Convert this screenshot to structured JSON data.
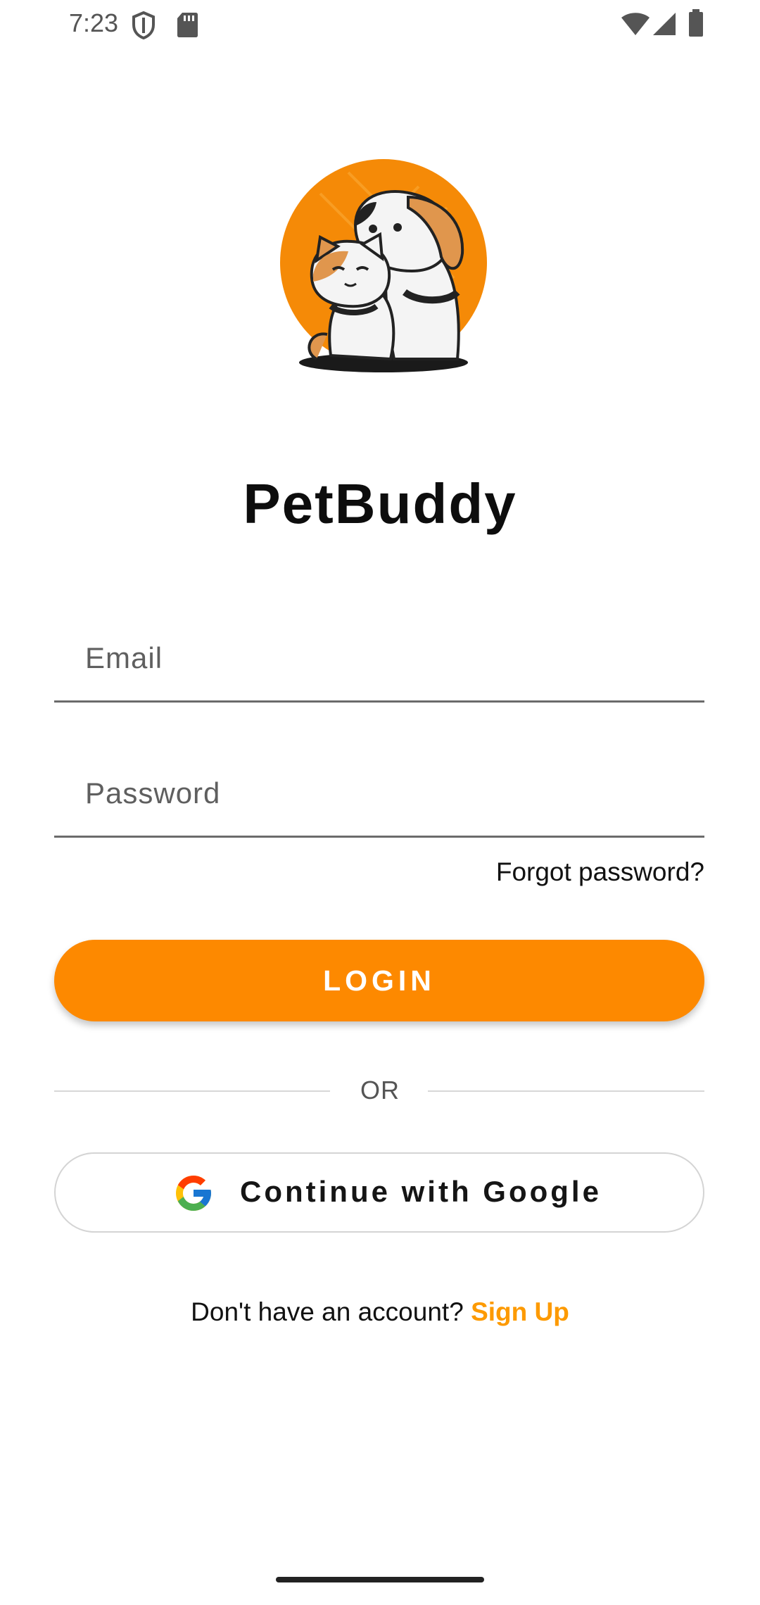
{
  "status_bar": {
    "time": "7:23",
    "icons": [
      "shield-icon",
      "sd-card-icon",
      "wifi-icon",
      "cell-signal-icon",
      "battery-icon"
    ]
  },
  "app": {
    "name": "PetBuddy",
    "logo": "pet-logo-dog-and-cat",
    "accent_color": "#FD8900"
  },
  "form": {
    "email_placeholder": "Email",
    "email_value": "",
    "password_placeholder": "Password",
    "password_value": "",
    "forgot_label": "Forgot password?",
    "login_label": "LOGIN"
  },
  "divider": {
    "label": "OR"
  },
  "google": {
    "label": "Continue with Google",
    "icon": "google-icon"
  },
  "signup": {
    "prompt": "Don't have an account?",
    "link_label": "Sign Up"
  }
}
